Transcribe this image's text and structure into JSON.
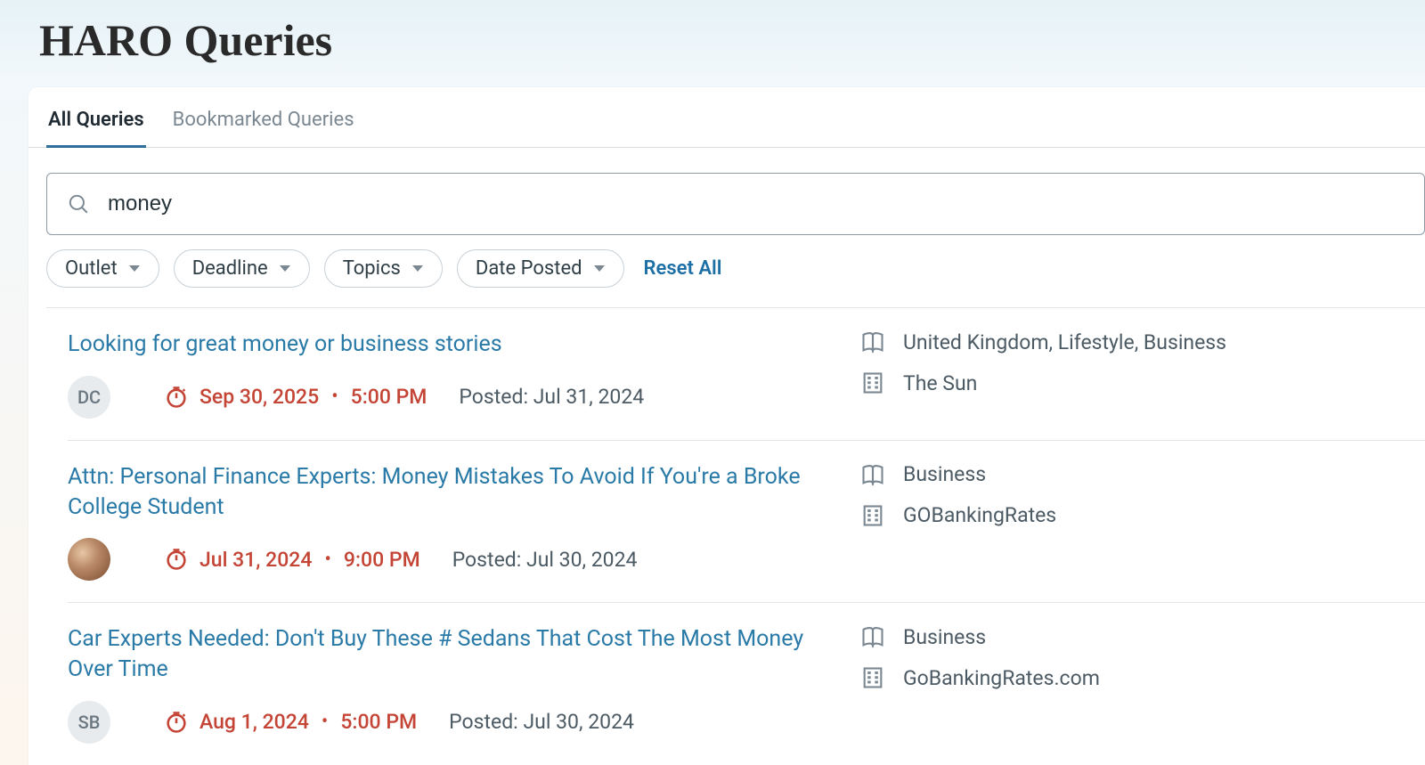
{
  "page_title": "HARO Queries",
  "tabs": {
    "all": "All Queries",
    "bookmarked": "Bookmarked Queries"
  },
  "search": {
    "value": "money"
  },
  "filters": {
    "outlet": "Outlet",
    "deadline": "Deadline",
    "topics": "Topics",
    "date_posted": "Date Posted",
    "reset": "Reset All"
  },
  "queries": [
    {
      "title": "Looking for great money or business stories",
      "avatar_type": "initials",
      "avatar_text": "DC",
      "deadline_date": "Sep 30, 2025",
      "deadline_time": "5:00 PM",
      "posted_label": "Posted: Jul 31, 2024",
      "topics": "United Kingdom, Lifestyle, Business",
      "outlet": "The Sun"
    },
    {
      "title": "Attn: Personal Finance Experts: Money Mistakes To Avoid If You're a Broke College Student",
      "avatar_type": "photo",
      "avatar_text": "",
      "deadline_date": "Jul 31, 2024",
      "deadline_time": "9:00 PM",
      "posted_label": "Posted: Jul 30, 2024",
      "topics": "Business",
      "outlet": "GOBankingRates"
    },
    {
      "title": "Car Experts Needed: Don't Buy These # Sedans That Cost The Most Money Over Time",
      "avatar_type": "initials",
      "avatar_text": "SB",
      "deadline_date": "Aug 1, 2024",
      "deadline_time": "5:00 PM",
      "posted_label": "Posted: Jul 30, 2024",
      "topics": "Business",
      "outlet": "GoBankingRates.com"
    }
  ]
}
